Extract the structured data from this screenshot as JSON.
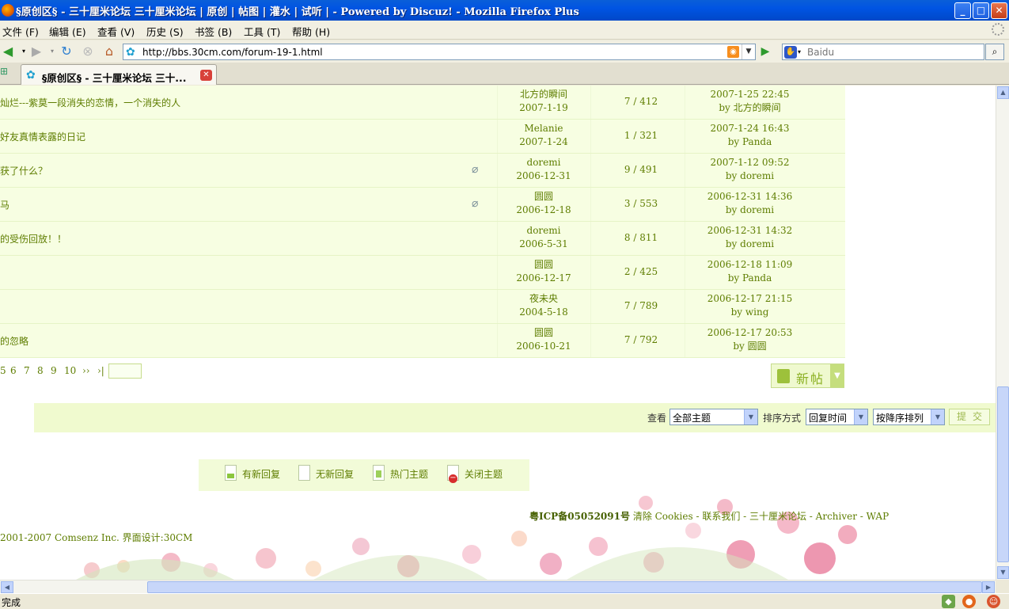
{
  "window": {
    "title": "§原创区§ - 三十厘米论坛 三十厘米论坛 | 原创 | 帖图 | 灌水 | 试听 | - Powered by Discuz! - Mozilla Firefox Plus",
    "min": "_",
    "max": "□",
    "close": "✕"
  },
  "menu": [
    "文件 (F)",
    "编辑 (E)",
    "查看 (V)",
    "历史 (S)",
    "书签 (B)",
    "工具 (T)",
    "帮助 (H)"
  ],
  "nav": {
    "url": "http://bbs.30cm.com/forum-19-1.html",
    "search_placeholder": "Baidu"
  },
  "tab": {
    "label": "§原创区§ - 三十厘米论坛 三十..."
  },
  "threads": [
    {
      "subject": "灿烂---紫莫一段消失的恋情，一个消失的人",
      "attach": false,
      "author": "北方的瞬间",
      "date": "2007-1-19",
      "counts": "7 / 412",
      "last_time": "2007-1-25 22:45",
      "last_by": "by 北方的瞬间"
    },
    {
      "subject": "好友真情表露的日记",
      "attach": false,
      "author": "Melanie",
      "date": "2007-1-24",
      "counts": "1 / 321",
      "last_time": "2007-1-24 16:43",
      "last_by": "by Panda"
    },
    {
      "subject": "获了什么？",
      "attach": true,
      "author": "doremi",
      "date": "2006-12-31",
      "counts": "9 / 491",
      "last_time": "2007-1-12 09:52",
      "last_by": "by doremi"
    },
    {
      "subject": "马",
      "attach": true,
      "author": "圆圆",
      "date": "2006-12-18",
      "counts": "3 / 553",
      "last_time": "2006-12-31 14:36",
      "last_by": "by doremi"
    },
    {
      "subject": "的受伤回放！！",
      "attach": false,
      "author": "doremi",
      "date": "2006-5-31",
      "counts": "8 / 811",
      "last_time": "2006-12-31 14:32",
      "last_by": "by doremi"
    },
    {
      "subject": "",
      "attach": false,
      "author": "圆圆",
      "date": "2006-12-17",
      "counts": "2 / 425",
      "last_time": "2006-12-18 11:09",
      "last_by": "by Panda"
    },
    {
      "subject": "",
      "attach": false,
      "author": "夜未央",
      "date": "2004-5-18",
      "counts": "7 / 789",
      "last_time": "2006-12-17 21:15",
      "last_by": "by wing"
    },
    {
      "subject": "的忽略",
      "attach": false,
      "author": "圆圆",
      "date": "2006-10-21",
      "counts": "7 / 792",
      "last_time": "2006-12-17 20:53",
      "last_by": "by 圆圆"
    }
  ],
  "pager": {
    "pages": [
      "5",
      "6",
      "7",
      "8",
      "9",
      "10"
    ],
    "next": "››",
    "last": "›|"
  },
  "newpost": {
    "label": "新帖"
  },
  "filter": {
    "view_label": "查看",
    "view_value": "全部主题",
    "sort_label": "排序方式",
    "sort_value": "回复时间",
    "order_value": "按降序排列",
    "submit": "提交"
  },
  "legend": [
    "有新回复",
    "无新回复",
    "热门主题",
    "关闭主题"
  ],
  "footer": {
    "icp": "粤ICP备05052091号",
    "links": " 清除 Cookies - 联系我们 - 三十厘米论坛 - Archiver - WAP",
    "copyright": "2001-2007 Comsenz Inc. 界面设计:30CM"
  },
  "status": {
    "text": "完成"
  }
}
